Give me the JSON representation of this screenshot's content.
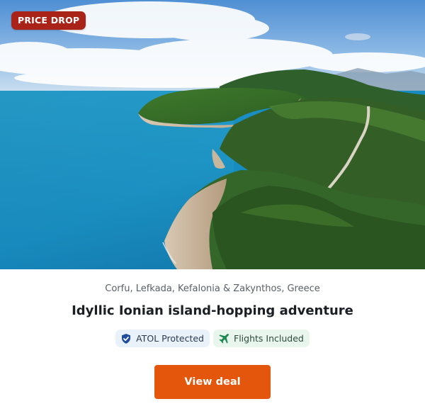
{
  "hero": {
    "badge_label": "PRICE DROP",
    "image_description_icon": "island-coastline-photo"
  },
  "deal": {
    "location": "Corfu, Lefkada, Kefalonia & Zakynthos, Greece",
    "title": "Idyllic Ionian island-hopping adventure",
    "tags": [
      {
        "label": "ATOL Protected",
        "icon": "shield-check-icon"
      },
      {
        "label": "Flights Included",
        "icon": "airplane-icon"
      }
    ],
    "cta_label": "View deal"
  },
  "colors": {
    "badge_bg": "#a92318",
    "cta_bg": "#e3560c",
    "atol_tag_bg": "#e9f2fb",
    "flights_tag_bg": "#e8f6ee",
    "shield_icon": "#1f4f9c",
    "plane_icon": "#1e8a52"
  }
}
